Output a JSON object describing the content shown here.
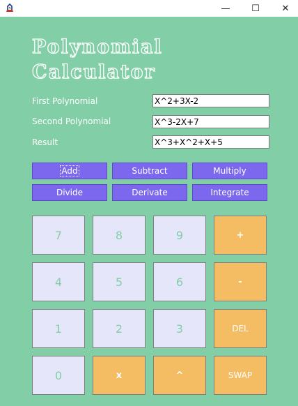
{
  "window": {
    "icon": "java-app-icon",
    "minimize_glyph": "—",
    "maximize_glyph": "☐",
    "close_glyph": "✕"
  },
  "title": "Polynomial\nCalculator",
  "fields": {
    "first_label": "First Polynomial",
    "first_value": "X^2+3X-2",
    "second_label": "Second Polynomial",
    "second_value": "X^3-2X+7",
    "result_label": "Result",
    "result_value": "X^3+X^2+X+5"
  },
  "operations": [
    "Add",
    "Subtract",
    "Multiply",
    "Divide",
    "Derivate",
    "Integrate"
  ],
  "keypad": [
    [
      "7",
      "8",
      "9",
      "+"
    ],
    [
      "4",
      "5",
      "6",
      "-"
    ],
    [
      "1",
      "2",
      "3",
      "DEL"
    ],
    [
      "0",
      "x",
      "^",
      "SWAP"
    ]
  ],
  "colors": {
    "background": "#82cea6",
    "operation_button": "#7b68ee",
    "digit_key": "#e6e6fa",
    "operator_key": "#f4bd63"
  }
}
